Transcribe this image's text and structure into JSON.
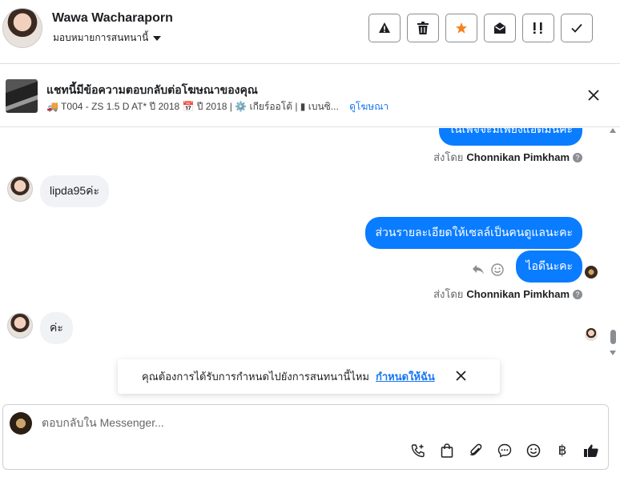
{
  "header": {
    "contact_name": "Wawa Wacharaporn",
    "assign_label": "มอบหมายการสนทนานี้"
  },
  "ad": {
    "title": "แชทนี้มีข้อความตอบกลับต่อโฆษณาของคุณ",
    "meta": "🚚 T004 - ZS 1.5 D AT* ปี 2018 📅 ปี 2018 | ⚙️ เกียร์ออโต้ | ▮ เบนซิ...",
    "link": "ดูโฆษณา"
  },
  "messages": {
    "out1_partial": "ในเพจจะมีเพียงแอดมินค่ะ",
    "sentby1_prefix": "ส่งโดย",
    "sentby1_name": "Chonnikan Pimkham",
    "in1": "lipda95ค่ะ",
    "out2": "ส่วนรายละเอียดให้เซลล์เป็นคนดูแลนะคะ",
    "out3": "ไอดีนะคะ",
    "sentby2_prefix": "ส่งโดย",
    "sentby2_name": "Chonnikan Pimkham",
    "in2": "ค่ะ"
  },
  "toast": {
    "text": "คุณต้องการได้รับการกำหนดไปยังการสนทนานี้ไหม",
    "link": "กำหนดให้ฉัน"
  },
  "composer": {
    "placeholder": "ตอบกลับใน Messenger..."
  },
  "icons": [
    "warning-icon",
    "trash-icon",
    "star-icon",
    "mail-open-icon",
    "priority-icon",
    "check-icon",
    "close-icon",
    "reply-icon",
    "emoji-icon",
    "call-add-icon",
    "bag-icon",
    "paperclip-icon",
    "chat-bubble-icon",
    "smile-icon",
    "baht-icon",
    "thumbs-up-icon"
  ],
  "colors": {
    "accent": "#0a7cff",
    "star": "#f5821f",
    "link": "#1877f2"
  }
}
